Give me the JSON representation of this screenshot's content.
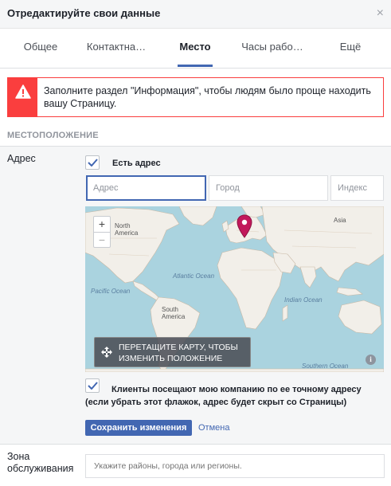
{
  "dialog": {
    "title": "Отредактируйте свои данные",
    "close_symbol": "×"
  },
  "tabs": [
    {
      "label": "Общее",
      "active": false
    },
    {
      "label": "Контактна…",
      "active": false
    },
    {
      "label": "Место",
      "active": true
    },
    {
      "label": "Часы рабо…",
      "active": false
    },
    {
      "label": "Ещё",
      "active": false
    }
  ],
  "alert": {
    "icon": "warning-icon",
    "text": "Заполните раздел \"Информация\", чтобы людям было проще находить вашу Страницу.",
    "color": "#fa3e3e"
  },
  "location": {
    "section_title": "МЕСТОПОЛОЖЕНИЕ",
    "address_label": "Адрес",
    "has_address_label": "Есть адрес",
    "has_address_checked": true,
    "fields": {
      "address_placeholder": "Адрес",
      "city_placeholder": "Город",
      "zip_placeholder": "Индекс"
    },
    "map": {
      "zoom_in": "+",
      "zoom_out": "−",
      "labels": {
        "north_america": "North America",
        "asia": "Asia",
        "atlantic": "Atlantic Ocean",
        "pacific": "Pacific Ocean",
        "south_america": "South America",
        "indian": "Indian Ocean",
        "southern": "Southern Ocean"
      },
      "drag_hint": "ПЕРЕТАЩИТЕ КАРТУ, ЧТОБЫ ИЗМЕНИТЬ ПОЛОЖЕНИЕ",
      "info_symbol": "i"
    },
    "customers_visit_checked": true,
    "customers_visit_label": "Клиенты посещают мою компанию по ее точному адресу (если убрать этот флажок, адрес будет скрыт со Страницы)",
    "save_label": "Сохранить изменения",
    "cancel_label": "Отмена"
  },
  "service_area": {
    "label": "Зона обслуживания",
    "placeholder": "Укажите районы, города или регионы."
  },
  "colors": {
    "accent": "#4267b2",
    "alert": "#fa3e3e",
    "water": "#aad3df",
    "land": "#f2efe9",
    "pin": "#c2185b"
  }
}
